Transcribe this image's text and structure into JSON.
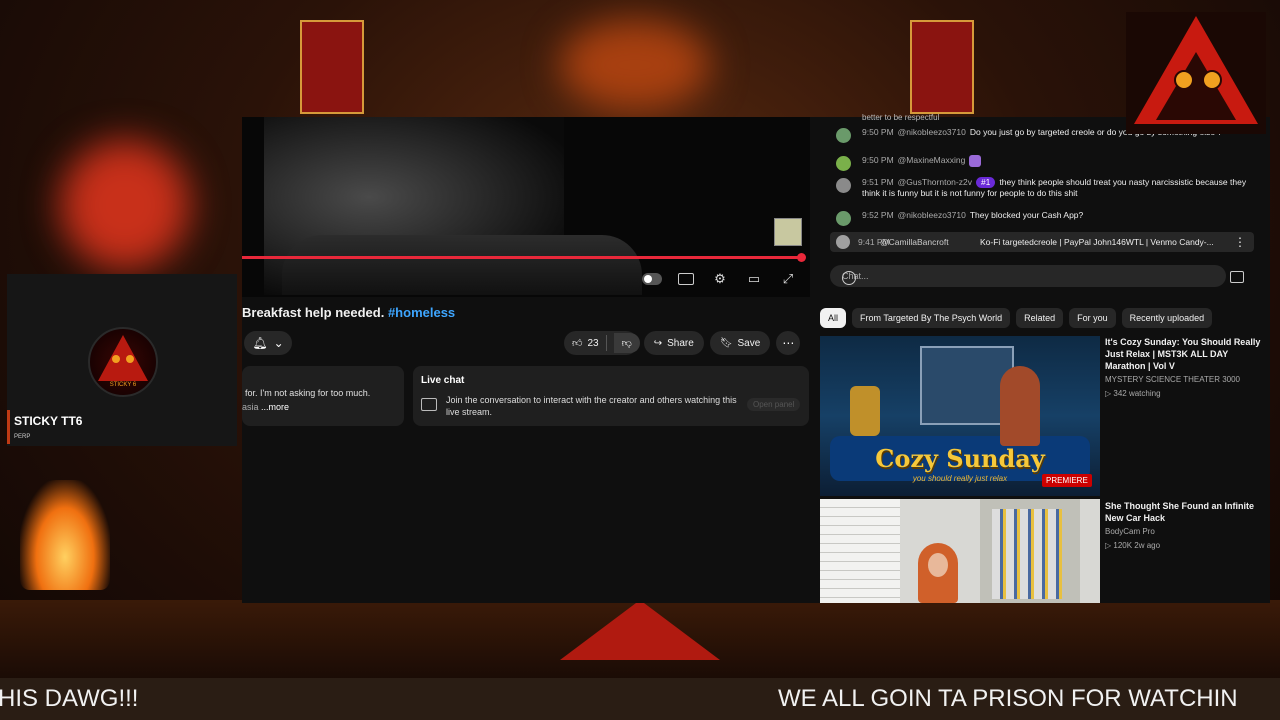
{
  "video": {
    "title": "Breakfast help needed.",
    "hashtag": "#homeless"
  },
  "actions": {
    "likes": "23",
    "share": "Share",
    "save": "Save"
  },
  "description": {
    "line1": "for. I'm not asking for too much.",
    "line2": "asia",
    "more": " ...more"
  },
  "livechat": {
    "heading": "Live chat",
    "text": "Join the conversation to interact with the creator and others watching this live stream.",
    "open": "Open panel"
  },
  "chat": {
    "cut_line": "better to be respectful",
    "messages": [
      {
        "time": "9:50 PM",
        "user": "@nikobleezo3710",
        "text": "Do you just go by targeted creole or do you go by something else ?"
      },
      {
        "time": "9:50 PM",
        "user": "@MaxineMaxxing",
        "text": ""
      },
      {
        "time": "9:51 PM",
        "user": "@GusThornton-z2v",
        "badge": "#1",
        "text": "they think people should treat you nasty narcissistic because they think it is funny but it is not funny for people to do this shit"
      },
      {
        "time": "9:52 PM",
        "user": "@nikobleezo3710",
        "text": "They blocked your Cash App?"
      }
    ],
    "pinned": {
      "time": "9:41 PM",
      "user": "@CamillaBancroft",
      "text": "Ko-Fi targetedcreole | PayPal John146WTL | Venmo Candy-..."
    },
    "input_placeholder": "Chat..."
  },
  "chips": [
    "All",
    "From Targeted By The Psych World",
    "Related",
    "For you",
    "Recently uploaded"
  ],
  "recommendations": [
    {
      "title": "It's Cozy Sunday: You Should Really Just Relax | MST3K ALL DAY Marathon | Vol V",
      "channel": "MYSTERY SCIENCE THEATER 3000",
      "meta": "342 watching",
      "thumb_big": "Cozy Sunday",
      "thumb_small": "you should really just relax",
      "thumb_badge": "PREMIERE"
    },
    {
      "title": "She Thought She Found an Infinite New Car Hack",
      "channel": "BodyCam Pro",
      "meta": "120K   2w ago"
    }
  ],
  "overlay": {
    "streamer_name": "STICKY TT6",
    "streamer_sub": "PERP",
    "avatar_text": "STICKY 6",
    "ticker_left": "HIS DAWG!!!",
    "ticker_right": "WE ALL GOIN TA PRISON FOR WATCHIN"
  },
  "colors": {
    "accent_red": "#e8283a",
    "link_blue": "#3ea6ff",
    "yt_bg": "#0f0f0f"
  }
}
